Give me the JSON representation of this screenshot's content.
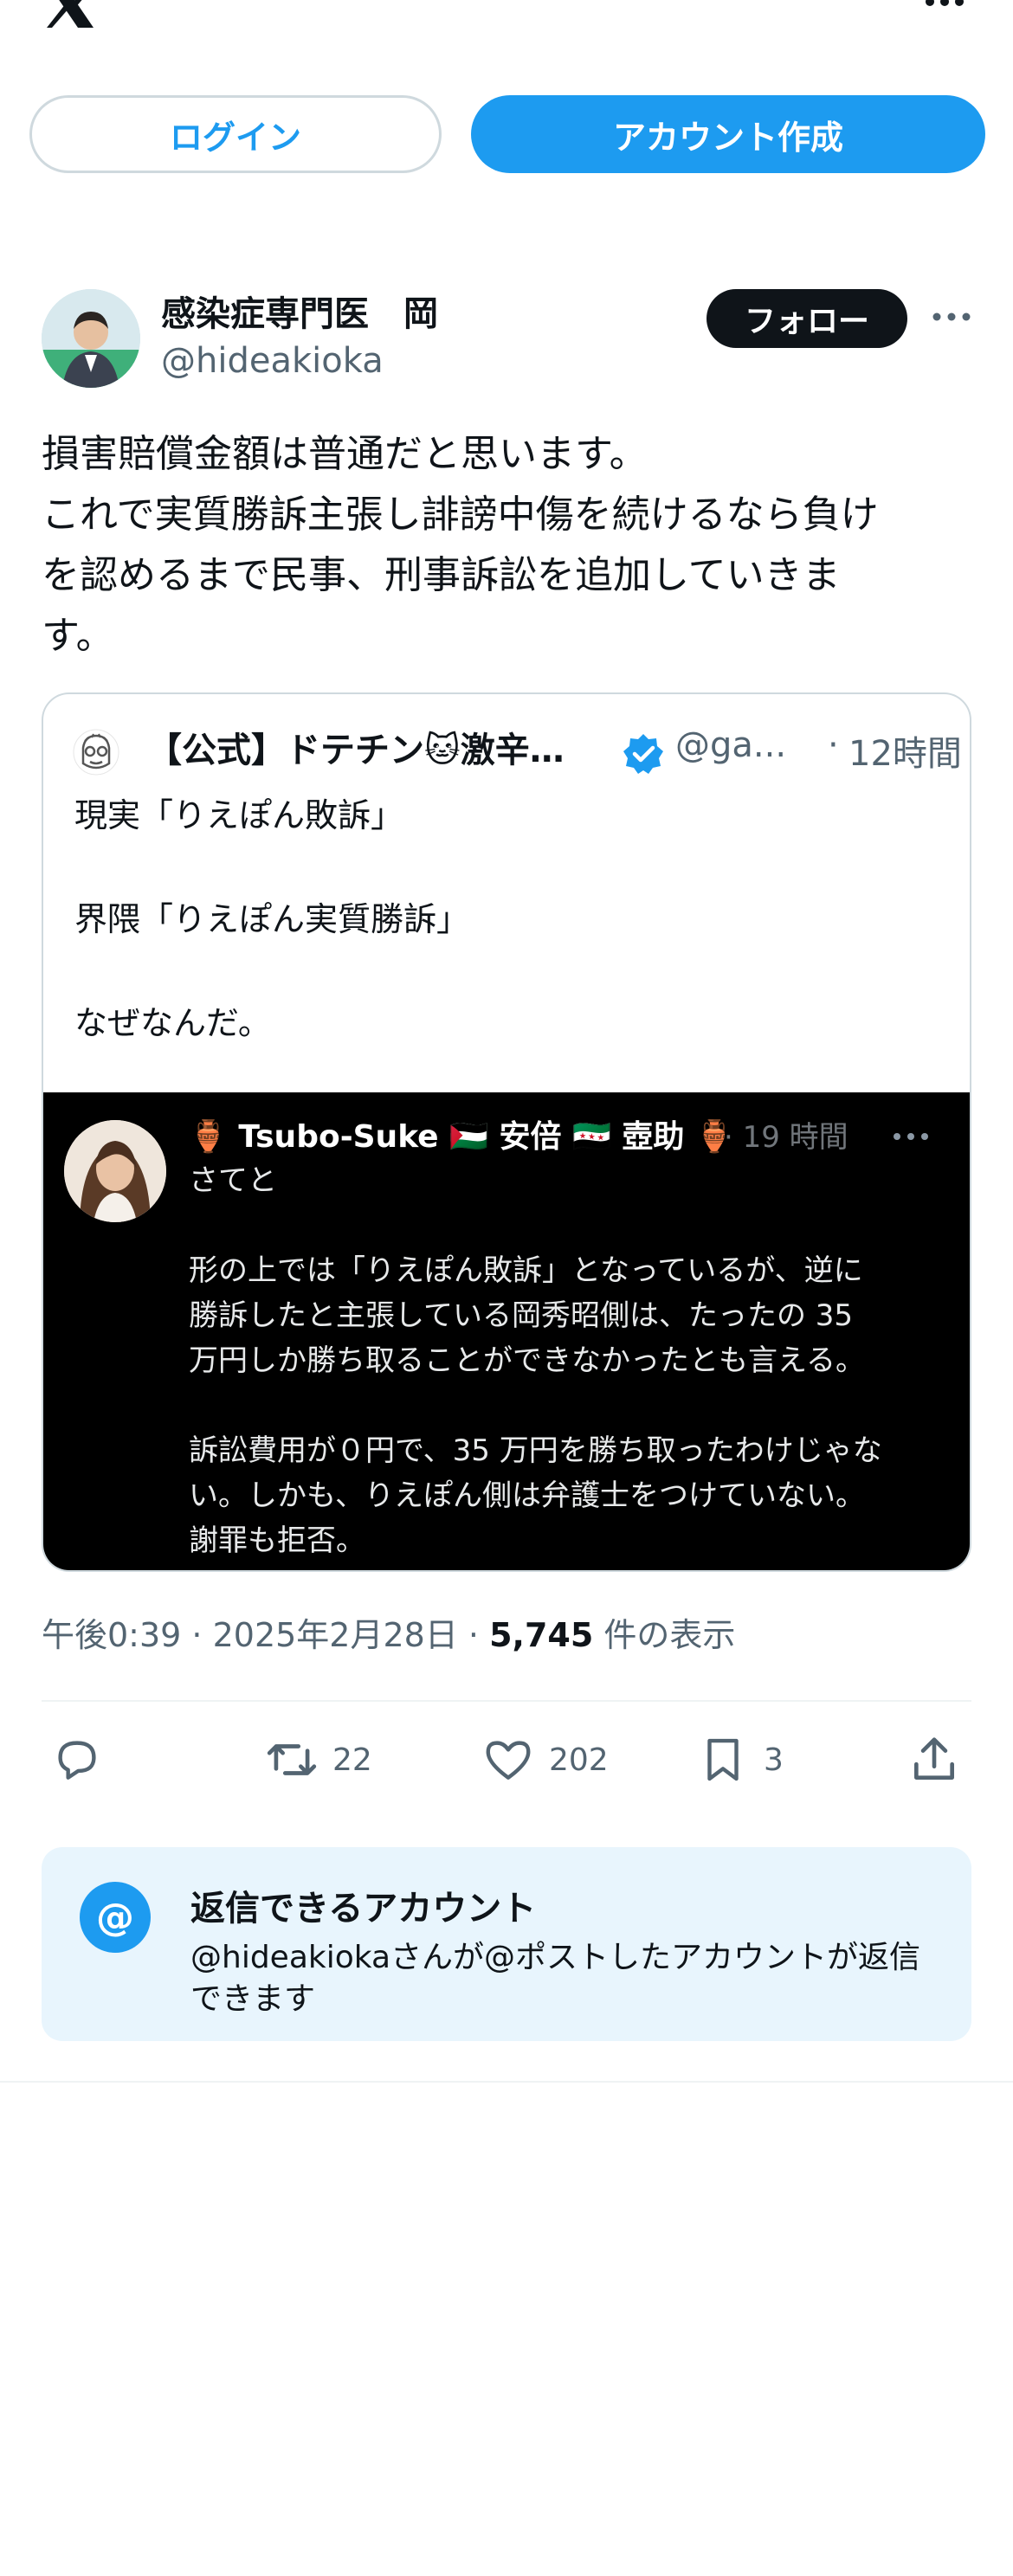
{
  "topbar": {
    "logo_icon": "x-logo-icon",
    "more_icon": "more-horizontal-icon"
  },
  "auth": {
    "login_label": "ログイン",
    "signup_label": "アカウント作成"
  },
  "author": {
    "name": "感染症専門医　岡",
    "handle": "@hideakioka",
    "follow_label": "フォロー"
  },
  "tweet": {
    "lines": [
      "損害賠償金額は普通だと思います。",
      "これで実質勝訴主張し誹謗中傷を続けるなら負け",
      "を認めるまで民事、刑事訴訟を追加していきま",
      "す。"
    ]
  },
  "quote": {
    "name": "【公式】ドテチン🐱激辛…",
    "handle": "@ga...",
    "dot": "·",
    "time": "12時間",
    "lines": [
      "現実「りえぽん敗訴」",
      "",
      "界隈「りえぽん実質勝訴」",
      "",
      "なぜなんだ。"
    ],
    "media": {
      "header": "🏺 Tsubo-Suke 🇵🇸 安倍 🇸🇾 壺助 🏺",
      "time": "· 19 時間",
      "lines": [
        "さてと",
        "",
        "形の上では「りえぽん敗訴」となっているが、逆に",
        "勝訴したと主張している岡秀昭側は、たったの 35",
        "万円しか勝ち取ることができなかったとも言える。",
        "",
        "訴訟費用が０円で、35 万円を勝ち取ったわけじゃな",
        "い。しかも、りえぽん側は弁護士をつけていない。",
        "謝罪も拒否。"
      ]
    }
  },
  "meta": {
    "time": "午後0:39",
    "sep": " · ",
    "date": "2025年2月28日",
    "views": "5,745",
    "views_label": " 件の表示"
  },
  "actions": {
    "reply": "",
    "retweets": "22",
    "likes": "202",
    "bookmarks": "3"
  },
  "reply_settings": {
    "icon": "@",
    "title": "返信できるアカウント",
    "description": "@hideakiokaさんが@ポストしたアカウントが返信できます"
  },
  "colors": {
    "accent": "#1d9bf0",
    "text": "#0f1419",
    "muted": "#536471",
    "reply_bg": "#e8f5fd"
  }
}
